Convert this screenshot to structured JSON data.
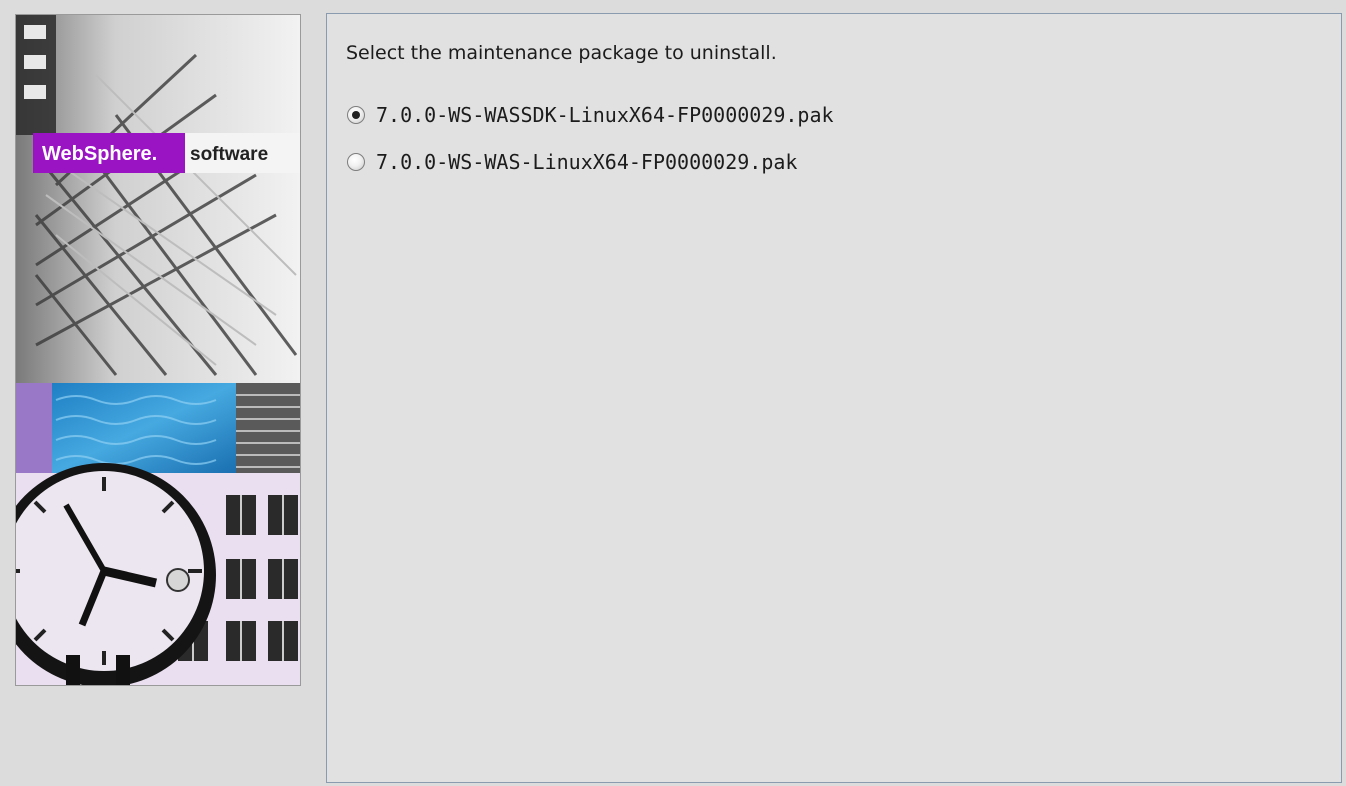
{
  "banner": {
    "brand": "WebSphere.",
    "brand_suffix": "software",
    "colors": {
      "brand_purple": "#9a14c4",
      "strip_purple": "#9a78c8",
      "water_blue": "#2a8ed0",
      "clock_face": "#ece6f0"
    },
    "icon": "websphere-banner-image"
  },
  "panel": {
    "prompt": "Select the maintenance package to uninstall.",
    "packages": [
      {
        "label": "7.0.0-WS-WASSDK-LinuxX64-FP0000029.pak",
        "selected": true
      },
      {
        "label": "7.0.0-WS-WAS-LinuxX64-FP0000029.pak",
        "selected": false
      }
    ]
  }
}
